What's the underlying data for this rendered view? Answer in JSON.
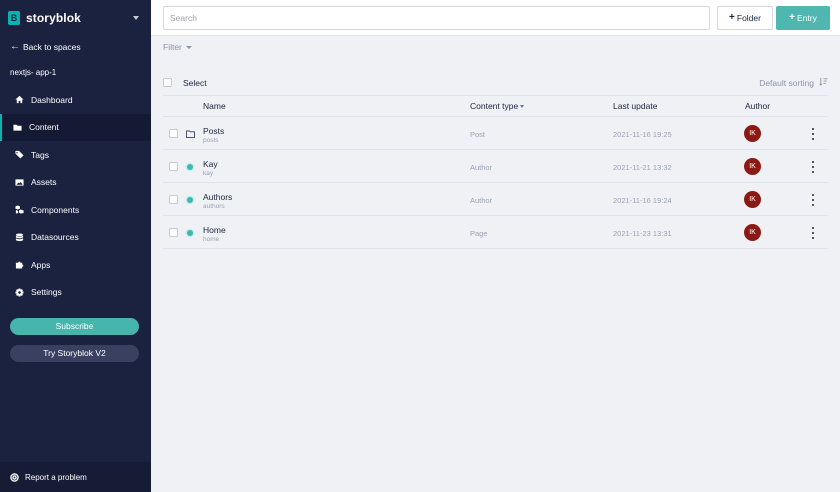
{
  "brand": {
    "logo_letter": "B",
    "name": "storyblok"
  },
  "sidebar": {
    "back_label": "Back to spaces",
    "space_name": "nextjs- app-1",
    "items": [
      {
        "label": "Dashboard",
        "icon": "home-icon"
      },
      {
        "label": "Content",
        "icon": "folder-icon",
        "active": true
      },
      {
        "label": "Tags",
        "icon": "tags-icon"
      },
      {
        "label": "Assets",
        "icon": "image-icon"
      },
      {
        "label": "Components",
        "icon": "cubes-icon"
      },
      {
        "label": "Datasources",
        "icon": "database-icon"
      },
      {
        "label": "Apps",
        "icon": "puzzle-icon"
      },
      {
        "label": "Settings",
        "icon": "gear-icon"
      }
    ],
    "subscribe_label": "Subscribe",
    "try_v2_label": "Try Storyblok V2",
    "report_label": "Report a problem"
  },
  "toolbar": {
    "search_placeholder": "Search",
    "folder_label": "Folder",
    "entry_label": "Entry",
    "filter_label": "Filter"
  },
  "list": {
    "select_label": "Select",
    "sorting_label": "Default sorting",
    "columns": {
      "name": "Name",
      "content_type": "Content type",
      "last_update": "Last update",
      "author": "Author"
    },
    "rows": [
      {
        "name": "Posts",
        "slug": "posts",
        "type": "Post",
        "date": "2021-11-16 19:25",
        "author": "IK",
        "kind": "folder"
      },
      {
        "name": "Kay",
        "slug": "kay",
        "type": "Author",
        "date": "2021-11-21 13:32",
        "author": "IK",
        "kind": "story"
      },
      {
        "name": "Authors",
        "slug": "authors",
        "type": "Author",
        "date": "2021-11-16 19:24",
        "author": "IK",
        "kind": "story"
      },
      {
        "name": "Home",
        "slug": "home",
        "type": "Page",
        "date": "2021-11-23 13:31",
        "author": "IK",
        "kind": "story"
      }
    ]
  },
  "colors": {
    "sidebar_bg": "#1b2240",
    "accent": "#4fb7b0",
    "avatar": "#8c1a14"
  }
}
